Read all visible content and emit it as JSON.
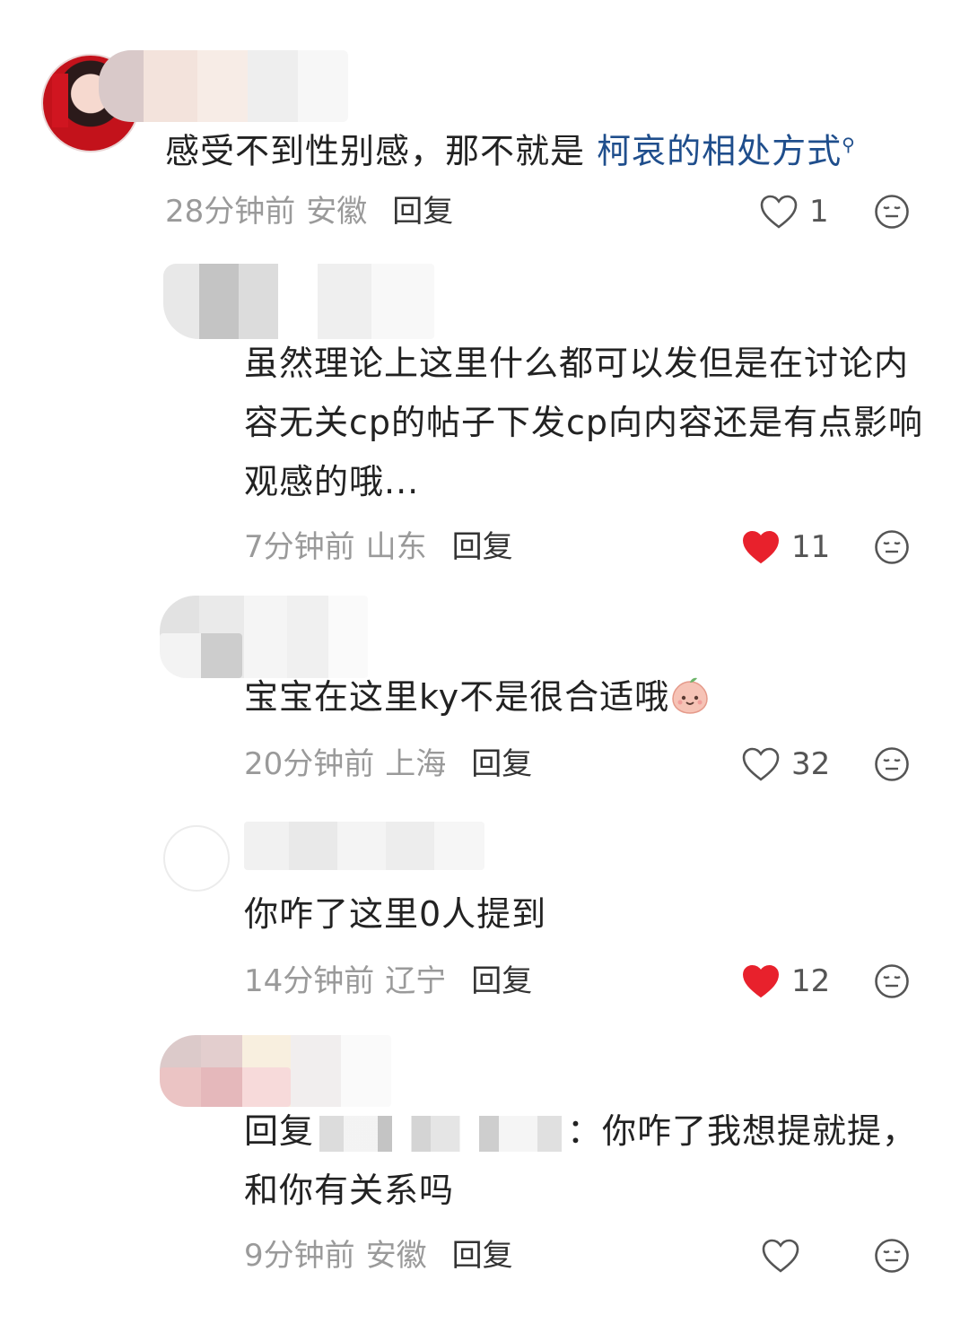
{
  "comments": [
    {
      "text_plain": "感受不到性别感，那不就是 ",
      "text_link": "柯哀的相处方式",
      "time": "28分钟前",
      "region": "安徽",
      "reply_label": "回复",
      "likes": "1",
      "liked": false
    },
    {
      "text": "虽然理论上这里什么都可以发但是在讨论内容无关cp的帖子下发cp向内容还是有点影响观感的哦...",
      "time": "7分钟前",
      "region": "山东",
      "reply_label": "回复",
      "likes": "11",
      "liked": true
    },
    {
      "text": "宝宝在这里ky不是很合适哦",
      "time": "20分钟前",
      "region": "上海",
      "reply_label": "回复",
      "likes": "32",
      "liked": false
    },
    {
      "text": "你咋了这里0人提到",
      "time": "14分钟前",
      "region": "辽宁",
      "reply_label": "回复",
      "likes": "12",
      "liked": true
    },
    {
      "reply_prefix": "回复",
      "reply_suffix": "：你咋了我想提就提，和你有关系吗",
      "time": "9分钟前",
      "region": "安徽",
      "reply_label": "回复",
      "likes": "",
      "liked": false
    }
  ],
  "icons": {
    "like": "heart-icon",
    "dislike": "meh-face-icon",
    "emoji": "peach-emoji-icon",
    "link_search": "search-icon"
  },
  "colors": {
    "liked": "#e8212c",
    "link": "#1f4e8c",
    "meta": "#9a9a9a"
  }
}
